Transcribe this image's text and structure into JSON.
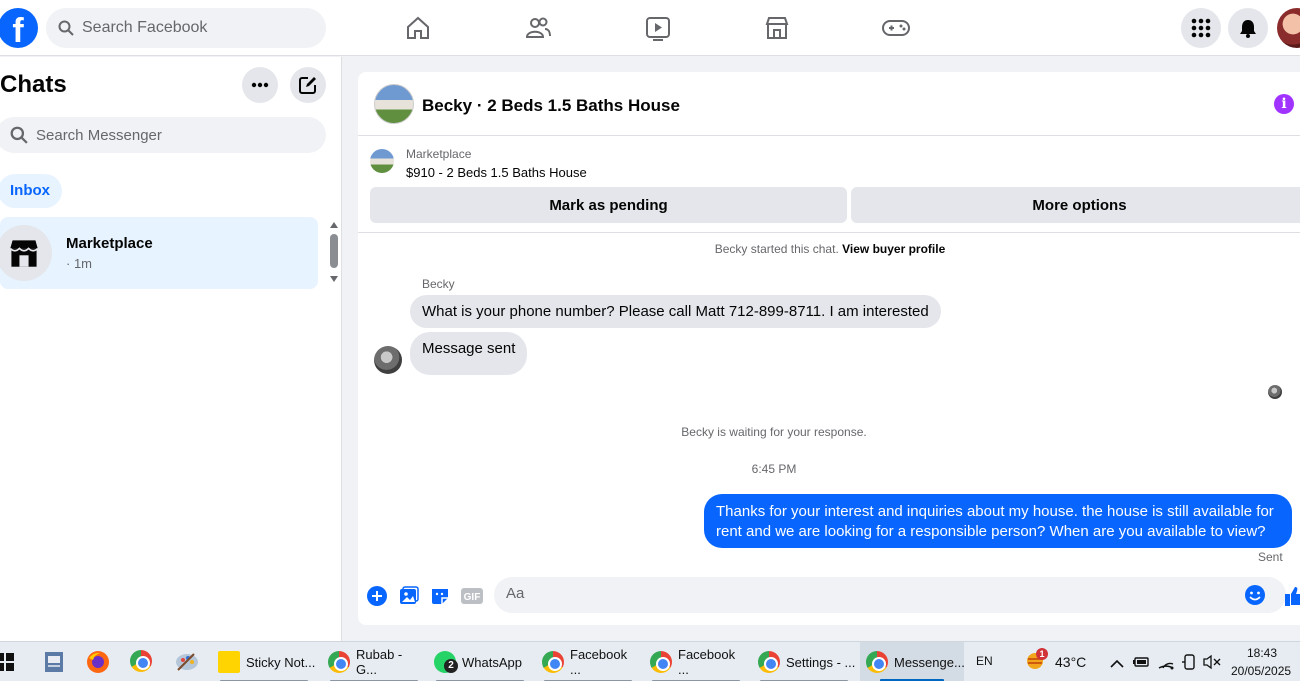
{
  "topbar": {
    "search_placeholder": "Search Facebook",
    "nav_icons": [
      "home-icon",
      "friends-icon",
      "video-icon",
      "marketplace-icon",
      "gaming-icon"
    ],
    "right_icons": [
      "menu-grid-icon",
      "notifications-icon",
      "profile-avatar"
    ]
  },
  "sidebar": {
    "title": "Chats",
    "search_placeholder": "Search Messenger",
    "filter_pill": "Inbox",
    "chats": [
      {
        "name": "Marketplace",
        "time": "· 1m",
        "icon": "marketplace-icon"
      }
    ]
  },
  "conversation": {
    "title": "Becky · 2 Beds 1.5 Baths House",
    "listing": {
      "label": "Marketplace",
      "text": "$910 - 2 Beds 1.5 Baths House",
      "primary_button": "Mark as pending",
      "secondary_button": "More options"
    },
    "started_note": "Becky started this chat.",
    "buyer_profile_link": "View buyer profile",
    "sender_name": "Becky",
    "incoming_messages": [
      "What is your phone number?  Please call Matt 712-899-8711.  I am interested",
      "Message sent"
    ],
    "waiting_note": "Becky is waiting for your response.",
    "timestamp": "6:45 PM",
    "outgoing_message": "Thanks for your interest and inquiries about my house. the house is still available for rent and we are looking for a responsible person? When are you available to view?",
    "status": "Sent",
    "composer_placeholder": "Aa",
    "gif_label": "GIF"
  },
  "taskbar": {
    "apps": [
      {
        "label": "Sticky Not...",
        "icon": "sticky-notes-icon"
      },
      {
        "label": "Rubab - G...",
        "icon": "chrome-icon"
      },
      {
        "label": "WhatsApp",
        "icon": "whatsapp-icon",
        "badge": "2"
      },
      {
        "label": "Facebook ...",
        "icon": "chrome-icon"
      },
      {
        "label": "Facebook ...",
        "icon": "chrome-icon"
      },
      {
        "label": "Settings - ...",
        "icon": "chrome-icon"
      },
      {
        "label": "Messenge...",
        "icon": "chrome-icon",
        "active": true
      }
    ],
    "language": "EN",
    "weather_badge": "1",
    "temperature": "43°C",
    "time": "18:43",
    "date": "20/05/2025"
  },
  "colors": {
    "facebook_blue": "#0866ff",
    "bubble_grey": "#e4e6eb",
    "info_purple": "#a033ff"
  }
}
